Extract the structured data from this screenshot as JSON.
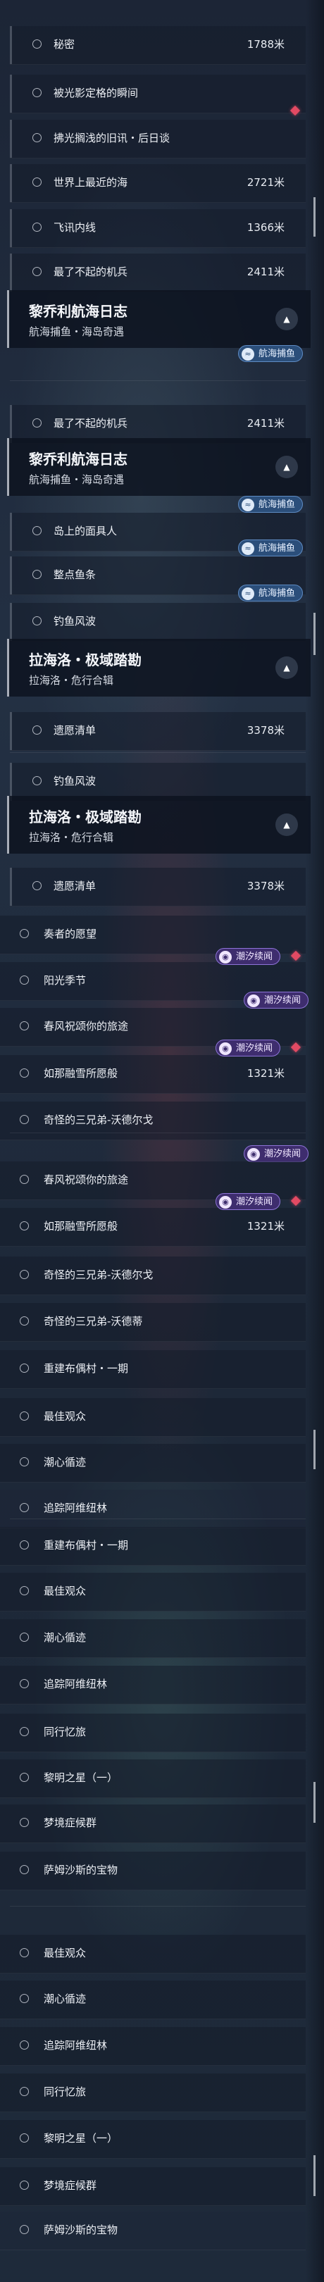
{
  "labels": {
    "item_1": "秘密",
    "item_2": "被光影定格的瞬间",
    "item_3": "拂光搁浅的旧讯・后日谈",
    "item_4": "世界上最近的海",
    "item_5": "飞讯内线",
    "item_6": "最了不起的机兵",
    "item_7": "岛上的面具人",
    "item_8": "整点鱼条",
    "item_9": "钓鱼风波",
    "item_10": "遗愿清单",
    "item_11": "奏者的愿望",
    "item_12": "阳光季节",
    "item_13": "春风祝颂你的旅途",
    "item_14": "如那融雪所愿般",
    "item_15": "奇怪的三兄弟-沃德尔戈",
    "item_16": "奇怪的三兄弟-沃德蒂",
    "item_17": "重建布偶村・一期",
    "item_18": "最佳观众",
    "item_19": "潮心循迹",
    "item_20": "追踪阿维纽林",
    "item_21": "同行忆旅",
    "item_22": "黎明之星（一）",
    "item_23": "梦境症候群",
    "item_24": "萨姆沙斯的宝物"
  },
  "values": {
    "v_1788": "1788米",
    "v_2721": "2721米",
    "v_1366": "1366米",
    "v_2411": "2411米",
    "v_3378": "3378米",
    "v_1321": "1321米"
  },
  "headers": {
    "lqn_title": "黎乔利航海日志",
    "lqn_sub": "航海捕鱼・海岛奇遇",
    "lhl_title": "拉海洛・极域踏勘",
    "lhl_sub": "拉海洛・危行合辑"
  },
  "tags": {
    "fishing": "航海捕鱼",
    "tide": "潮汐续闻"
  },
  "icons": {
    "chevron": "chevron-up-icon",
    "circle": "circle-outline-icon",
    "diamond": "alert-diamond-icon",
    "fishing_tag": "fish-icon",
    "tide_tag": "tide-icon"
  },
  "colors": {
    "tag_blue": "#2b4e7a",
    "tag_purple": "#3e2d6e",
    "alert": "#e24a63"
  }
}
